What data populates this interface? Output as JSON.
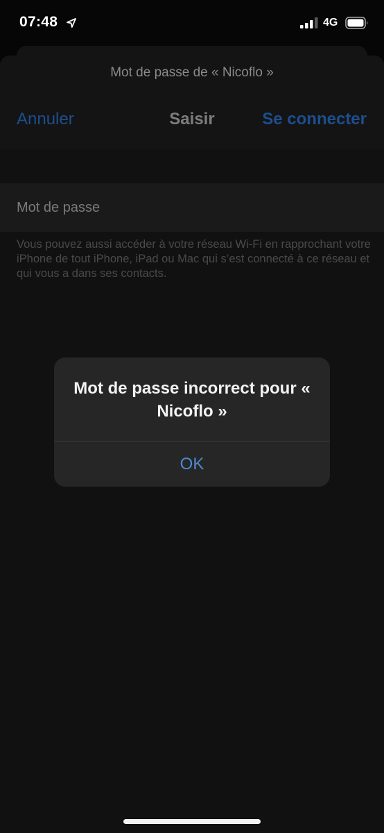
{
  "status_bar": {
    "time": "07:48",
    "network": "4G",
    "icons": [
      "location-arrow-icon",
      "signal-bars-icon",
      "battery-icon"
    ]
  },
  "nav": {
    "prompt": "Mot de passe de « Nicoflo »",
    "cancel_label": "Annuler",
    "title": "Saisir",
    "connect_label": "Se connecter"
  },
  "form": {
    "password_placeholder": "Mot de passe",
    "footer_note": "Vous pouvez aussi accéder à votre réseau Wi-Fi en rapprochant votre iPhone de tout iPhone, iPad ou Mac qui s’est connecté à ce réseau et qui vous a dans ses contacts."
  },
  "alert": {
    "title": "Mot de passe incorrect pour « Nicoflo »",
    "ok_label": "OK"
  },
  "colors": {
    "accent_blue": "#4f88d6",
    "dimmed_blue": "#1d4e8f",
    "alert_background": "#262626",
    "sheet_background": "#111111"
  }
}
